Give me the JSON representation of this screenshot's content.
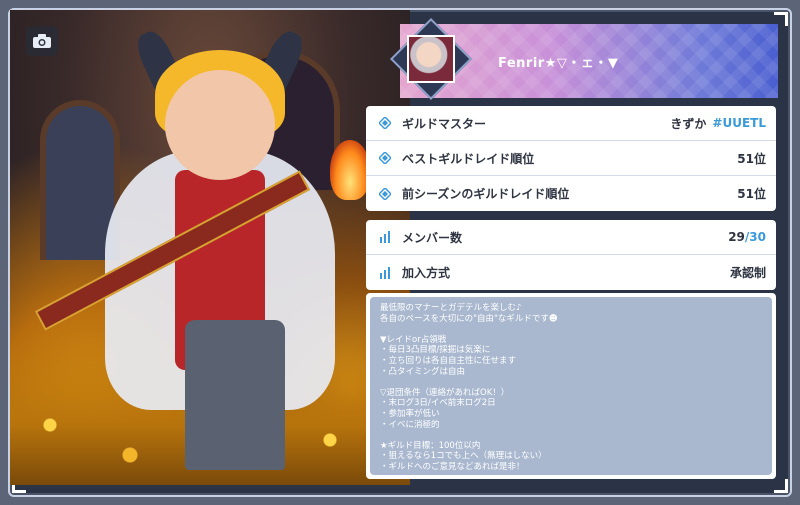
{
  "header": {
    "guild_name": "Fenrir★▽・ェ・▼"
  },
  "icons": {
    "camera": "camera-icon",
    "diamond": "diamond-bullet-icon",
    "bars": "bar-chart-icon"
  },
  "rows_top": [
    {
      "label": "ギルドマスター",
      "value": "きずか",
      "tag": "#UUETL"
    },
    {
      "label": "ベストギルドレイド順位",
      "value": "51位"
    },
    {
      "label": "前シーズンのギルドレイド順位",
      "value": "51位"
    }
  ],
  "members": {
    "label": "メンバー数",
    "current": "29",
    "max": "/30"
  },
  "join": {
    "label": "加入方式",
    "value": "承認制"
  },
  "description": "最低限のマナーとガデテルを楽しむ♪\n各自のペースを大切にの\"自由\"なギルドです☻\n\n▼レイドor占領戦\n・毎日3凸目標/採掘は気楽に\n・立ち回りは各自自主性に任せます\n・凸タイミングは自由\n\n▽退団条件（連絡があればOK！）\n・末ログ3日/イベ前末ログ2日\n・参加率が低い\n・イベに消極的\n\n★ギルド目標：100位以内\n・狙えるなら1コでも上へ（無理はしない）\n・ギルドへのご意見などあれば是非！",
  "colors": {
    "accent": "#3a9ad9",
    "header_gradient_start": "#e5a6cf",
    "header_gradient_end": "#4a5ed0",
    "description_bg": "#a9b8cf"
  }
}
